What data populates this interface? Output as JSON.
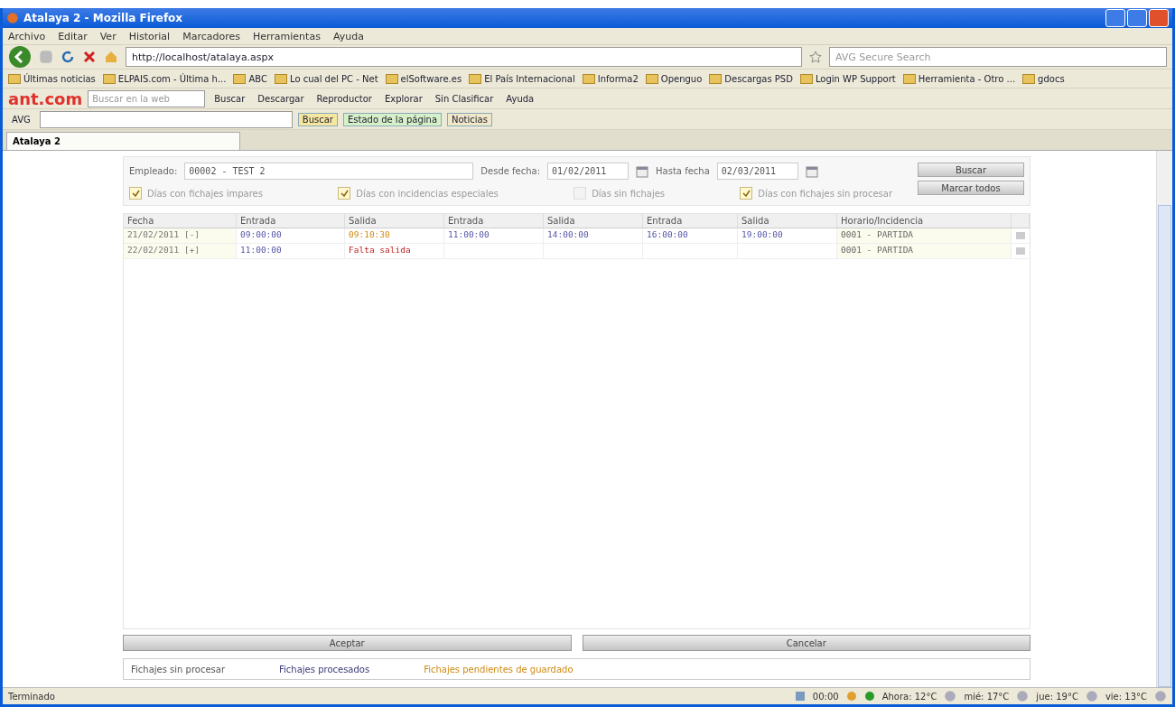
{
  "window": {
    "title": "Atalaya 2 - Mozilla Firefox"
  },
  "menu": [
    "Archivo",
    "Editar",
    "Ver",
    "Historial",
    "Marcadores",
    "Herramientas",
    "Ayuda"
  ],
  "navigation": {
    "url": "http://localhost/atalaya.aspx",
    "search_placeholder": "AVG Secure Search"
  },
  "bookmarks": [
    "Últimas noticias",
    "ELPAIS.com - Última h...",
    "ABC",
    "Lo cual del PC - Net",
    "elSoftware.es",
    "El País Internacional",
    "Informa2",
    "Openguo",
    "Descargas PSD",
    "Login WP Support",
    "Herramienta - Otro ...",
    "gdocs"
  ],
  "ant_toolbar": {
    "logo": "ant.com",
    "search_placeholder": "Buscar en la web",
    "buttons": [
      "Buscar",
      "Descargar",
      "Reproductor",
      "Explorar",
      "Sin Clasificar",
      "Ayuda"
    ]
  },
  "avg_toolbar": {
    "logo": "AVG",
    "buttons": [
      "Buscar",
      "Estado de la página",
      "Noticias"
    ]
  },
  "tabs": [
    {
      "label": "Atalaya 2",
      "selected": true
    }
  ],
  "filters": {
    "employee_label": "Empleado:",
    "employee_value": "00002 - TEST 2",
    "from_label": "Desde fecha:",
    "from_value": "01/02/2011",
    "to_label": "Hasta fecha",
    "to_value": "02/03/2011",
    "buttons": [
      "Buscar",
      "Marcar todos"
    ],
    "options": [
      {
        "label": "Días con fichajes impares",
        "checked": true
      },
      {
        "label": "Días con incidencias especiales",
        "checked": true
      },
      {
        "label": "Días sin fichajes",
        "checked": false
      },
      {
        "label": "Días con fichajes sin procesar",
        "checked": true
      }
    ]
  },
  "table": {
    "columns": [
      "Fecha",
      "Entrada",
      "Salida",
      "Entrada",
      "Salida",
      "Entrada",
      "Salida",
      "Horario/Incidencia"
    ],
    "rows": [
      {
        "cells": [
          {
            "text": "21/02/2011 [-]",
            "kind": "date"
          },
          {
            "text": "09:00:00",
            "kind": "time"
          },
          {
            "text": "09:10:30",
            "kind": "pending"
          },
          {
            "text": "11:00:00",
            "kind": "time"
          },
          {
            "text": "14:00:00",
            "kind": "time"
          },
          {
            "text": "16:00:00",
            "kind": "time"
          },
          {
            "text": "19:00:00",
            "kind": "time"
          },
          {
            "text": "0001 - PARTIDA",
            "kind": "schedule"
          }
        ]
      },
      {
        "cells": [
          {
            "text": "22/02/2011 [+]",
            "kind": "date"
          },
          {
            "text": "11:00:00",
            "kind": "time"
          },
          {
            "text": "Falta salida",
            "kind": "missing"
          },
          {
            "text": "",
            "kind": "time"
          },
          {
            "text": "",
            "kind": "time"
          },
          {
            "text": "",
            "kind": "time"
          },
          {
            "text": "",
            "kind": "time"
          },
          {
            "text": "0001 - PARTIDA",
            "kind": "schedule"
          }
        ]
      }
    ]
  },
  "actions": [
    "Aceptar",
    "Cancelar"
  ],
  "legend": [
    {
      "label": "Fichajes sin procesar",
      "color": "#555555"
    },
    {
      "label": "Fichajes procesados",
      "color": "#3a3a7a"
    },
    {
      "label": "Fichajes pendientes de guardado",
      "color": "#d08a10"
    }
  ],
  "status_bar": {
    "text": "Terminado",
    "clock": "00:00",
    "weather": [
      "Ahora: 12°C",
      "mié: 17°C",
      "jue: 19°C",
      "vie: 13°C"
    ]
  }
}
